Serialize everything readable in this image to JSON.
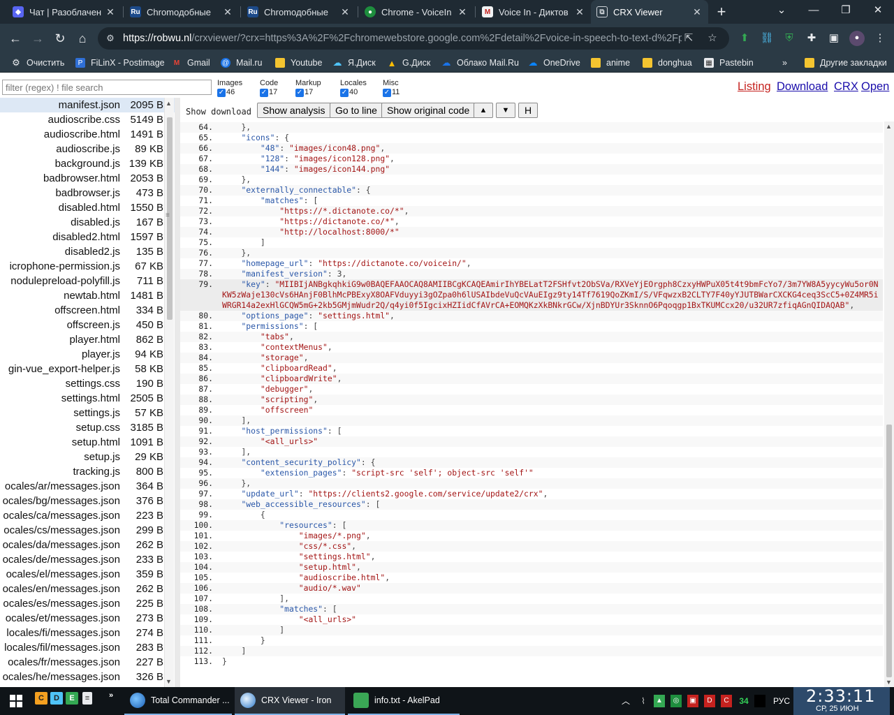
{
  "browser": {
    "tabs": [
      {
        "title": "Чат | Разоблачени",
        "favicon": "chat-favicon",
        "color": "#5865f2"
      },
      {
        "title": "Chromодобные",
        "favicon": "ru-favicon",
        "color": "#1c4a8a"
      },
      {
        "title": "Chromодобные",
        "favicon": "ru-favicon",
        "color": "#1c4a8a"
      },
      {
        "title": "Chrome - VoiceIn",
        "favicon": "chrome-favicon",
        "color": "#1e8e3e"
      },
      {
        "title": "Voice In - Диктов",
        "favicon": "gmail-favicon",
        "color": "#c5221f"
      },
      {
        "title": "CRX Viewer",
        "favicon": "crx-favicon",
        "color": "#3c4043"
      }
    ],
    "url_host": "https://robwu.nl",
    "url_rest": "/crxviewer/?crx=https%3A%2F%2Fchromewebstore.google.com%2Fdetail%2Fvoice-in-speech-to-text-d%2Fpjn...",
    "bookmarks": [
      {
        "label": "Очистить",
        "icon": "gear-icon"
      },
      {
        "label": "FiLinX - Postimage",
        "icon": "postimage-icon"
      },
      {
        "label": "Gmail",
        "icon": "gmail-icon"
      },
      {
        "label": "Mail.ru",
        "icon": "mail-icon"
      },
      {
        "label": "Youtube",
        "icon": "folder-icon"
      },
      {
        "label": "Я.Диск",
        "icon": "yadisk-icon"
      },
      {
        "label": "G.Диск",
        "icon": "gdrive-icon"
      },
      {
        "label": "Облако Mail.Ru",
        "icon": "cloud-icon"
      },
      {
        "label": "OneDrive",
        "icon": "onedrive-icon"
      },
      {
        "label": "anime",
        "icon": "folder-icon"
      },
      {
        "label": "donghua",
        "icon": "folder-icon"
      },
      {
        "label": "Pastebin",
        "icon": "pastebin-icon"
      }
    ],
    "bookmarks_more": "»",
    "other_bookmarks": "Другие закладки"
  },
  "viewer": {
    "filter_placeholder": "filter (regex) ! file search",
    "categories": [
      {
        "label": "Images",
        "count": "46"
      },
      {
        "label": "Code",
        "count": "17"
      },
      {
        "label": "Markup",
        "count": "17"
      },
      {
        "label": "Locales",
        "count": "40"
      },
      {
        "label": "Misc",
        "count": "11"
      }
    ],
    "links": {
      "listing": "Listing",
      "download": "Download",
      "crx": "CRX",
      "open": "Open"
    },
    "show_download": "Show download",
    "buttons": {
      "show_analysis": "Show analysis",
      "go_to_line": "Go to line",
      "show_original": "Show original code",
      "up": "▲",
      "down": "▼",
      "h": "H"
    },
    "files": [
      {
        "name": "manifest.json",
        "size": "2095 B"
      },
      {
        "name": "audioscribe.css",
        "size": "5149 B"
      },
      {
        "name": "audioscribe.html",
        "size": "1491 B"
      },
      {
        "name": "audioscribe.js",
        "size": "89 KB"
      },
      {
        "name": "background.js",
        "size": "139 KB"
      },
      {
        "name": "badbrowser.html",
        "size": "2053 B"
      },
      {
        "name": "badbrowser.js",
        "size": "473 B"
      },
      {
        "name": "disabled.html",
        "size": "1550 B"
      },
      {
        "name": "disabled.js",
        "size": "167 B"
      },
      {
        "name": "disabled2.html",
        "size": "1597 B"
      },
      {
        "name": "disabled2.js",
        "size": "135 B"
      },
      {
        "name": "icrophone-permission.js",
        "size": "67 KB"
      },
      {
        "name": "nodulepreload-polyfill.js",
        "size": "711 B"
      },
      {
        "name": "newtab.html",
        "size": "1481 B"
      },
      {
        "name": "offscreen.html",
        "size": "334 B"
      },
      {
        "name": "offscreen.js",
        "size": "450 B"
      },
      {
        "name": "player.html",
        "size": "862 B"
      },
      {
        "name": "player.js",
        "size": "94 KB"
      },
      {
        "name": "gin-vue_export-helper.js",
        "size": "58 KB"
      },
      {
        "name": "settings.css",
        "size": "190 B"
      },
      {
        "name": "settings.html",
        "size": "2505 B"
      },
      {
        "name": "settings.js",
        "size": "57 KB"
      },
      {
        "name": "setup.css",
        "size": "3185 B"
      },
      {
        "name": "setup.html",
        "size": "1091 B"
      },
      {
        "name": "setup.js",
        "size": "29 KB"
      },
      {
        "name": "tracking.js",
        "size": "800 B"
      },
      {
        "name": "ocales/ar/messages.json",
        "size": "364 B"
      },
      {
        "name": "ocales/bg/messages.json",
        "size": "376 B"
      },
      {
        "name": "ocales/ca/messages.json",
        "size": "223 B"
      },
      {
        "name": "ocales/cs/messages.json",
        "size": "299 B"
      },
      {
        "name": "ocales/da/messages.json",
        "size": "262 B"
      },
      {
        "name": "ocales/de/messages.json",
        "size": "233 B"
      },
      {
        "name": "ocales/el/messages.json",
        "size": "359 B"
      },
      {
        "name": "ocales/en/messages.json",
        "size": "262 B"
      },
      {
        "name": "ocales/es/messages.json",
        "size": "225 B"
      },
      {
        "name": "ocales/et/messages.json",
        "size": "273 B"
      },
      {
        "name": "locales/fi/messages.json",
        "size": "274 B"
      },
      {
        "name": "locales/fil/messages.json",
        "size": "283 B"
      },
      {
        "name": "ocales/fr/messages.json",
        "size": "227 B"
      },
      {
        "name": "ocales/he/messages.json",
        "size": "326 B"
      }
    ],
    "code_lines": [
      {
        "n": "64.",
        "t": "    },"
      },
      {
        "n": "65.",
        "t": "    \"icons\": {"
      },
      {
        "n": "66.",
        "t": "        \"48\": \"images/icon48.png\","
      },
      {
        "n": "67.",
        "t": "        \"128\": \"images/icon128.png\","
      },
      {
        "n": "68.",
        "t": "        \"144\": \"images/icon144.png\""
      },
      {
        "n": "69.",
        "t": "    },"
      },
      {
        "n": "70.",
        "t": "    \"externally_connectable\": {"
      },
      {
        "n": "71.",
        "t": "        \"matches\": ["
      },
      {
        "n": "72.",
        "t": "            \"https://*.dictanote.co/*\","
      },
      {
        "n": "73.",
        "t": "            \"https://dictanote.co/*\","
      },
      {
        "n": "74.",
        "t": "            \"http://localhost:8000/*\""
      },
      {
        "n": "75.",
        "t": "        ]"
      },
      {
        "n": "76.",
        "t": "    },"
      },
      {
        "n": "77.",
        "t": "    \"homepage_url\": \"https://dictanote.co/voicein/\","
      },
      {
        "n": "78.",
        "t": "    \"manifest_version\": 3,"
      },
      {
        "n": "79.",
        "t": "    \"key\": \"MIIBIjANBgkqhkiG9w0BAQEFAAOCAQ8AMIIBCgKCAQEAmirIhYBELatT2FSHfvt2ObSVa/RXVeYjEOrgph8CzxyHWPuX05t4t9bmFcYo7/3m7YW8A5yycyWu5or0NKW5zWaje130cVs6HAnjF0BlhMcPBExyX8OAFVduyyi3gOZpa0h6lUSAIbdeVuQcVAuEIgz9ty14Tf7619QoZKmI/S/VFqwzxB2CLTY7F40yYJUTBWarCXCKG4ceq3ScC5+0Z4MR5iWRGR14a2exHlGCQW5mG+2kb5GMjmWudr2Q/q4yi0f5IgcixHZIidCfAVrCA+EOMQKzXkBNkrGCw/XjnBDYUr3SknnO6Pqoqgp1BxTKUMCcx20/u32UR7zfiqAGnQIDAQAB\","
      },
      {
        "n": "80.",
        "t": "    \"options_page\": \"settings.html\","
      },
      {
        "n": "81.",
        "t": "    \"permissions\": ["
      },
      {
        "n": "82.",
        "t": "        \"tabs\","
      },
      {
        "n": "83.",
        "t": "        \"contextMenus\","
      },
      {
        "n": "84.",
        "t": "        \"storage\","
      },
      {
        "n": "85.",
        "t": "        \"clipboardRead\","
      },
      {
        "n": "86.",
        "t": "        \"clipboardWrite\","
      },
      {
        "n": "87.",
        "t": "        \"debugger\","
      },
      {
        "n": "88.",
        "t": "        \"scripting\","
      },
      {
        "n": "89.",
        "t": "        \"offscreen\""
      },
      {
        "n": "90.",
        "t": "    ],"
      },
      {
        "n": "91.",
        "t": "    \"host_permissions\": ["
      },
      {
        "n": "92.",
        "t": "        \"<all_urls>\""
      },
      {
        "n": "93.",
        "t": "    ],"
      },
      {
        "n": "94.",
        "t": "    \"content_security_policy\": {"
      },
      {
        "n": "95.",
        "t": "        \"extension_pages\": \"script-src 'self'; object-src 'self'\""
      },
      {
        "n": "96.",
        "t": "    },"
      },
      {
        "n": "97.",
        "t": "    \"update_url\": \"https://clients2.google.com/service/update2/crx\","
      },
      {
        "n": "98.",
        "t": "    \"web_accessible_resources\": ["
      },
      {
        "n": "99.",
        "t": "        {"
      },
      {
        "n": "100.",
        "t": "            \"resources\": ["
      },
      {
        "n": "101.",
        "t": "                \"images/*.png\","
      },
      {
        "n": "102.",
        "t": "                \"css/*.css\","
      },
      {
        "n": "103.",
        "t": "                \"settings.html\","
      },
      {
        "n": "104.",
        "t": "                \"setup.html\","
      },
      {
        "n": "105.",
        "t": "                \"audioscribe.html\","
      },
      {
        "n": "106.",
        "t": "                \"audio/*.wav\""
      },
      {
        "n": "107.",
        "t": "            ],"
      },
      {
        "n": "108.",
        "t": "            \"matches\": ["
      },
      {
        "n": "109.",
        "t": "                \"<all_urls>\""
      },
      {
        "n": "110.",
        "t": "            ]"
      },
      {
        "n": "111.",
        "t": "        }"
      },
      {
        "n": "112.",
        "t": "    ]"
      },
      {
        "n": "113.",
        "t": "}"
      }
    ]
  },
  "taskbar": {
    "quick_icons": [
      "C",
      "D",
      "E"
    ],
    "apps": [
      {
        "label": "Total Commander ...",
        "icon": "total-commander-icon"
      },
      {
        "label": "CRX Viewer - Iron",
        "icon": "iron-browser-icon"
      },
      {
        "label": "info.txt - AkelPad",
        "icon": "akelpad-icon"
      }
    ],
    "tray_number": "34",
    "lang": "РУС",
    "time": "2:33:11",
    "date": "СР, 25 ИЮН"
  }
}
